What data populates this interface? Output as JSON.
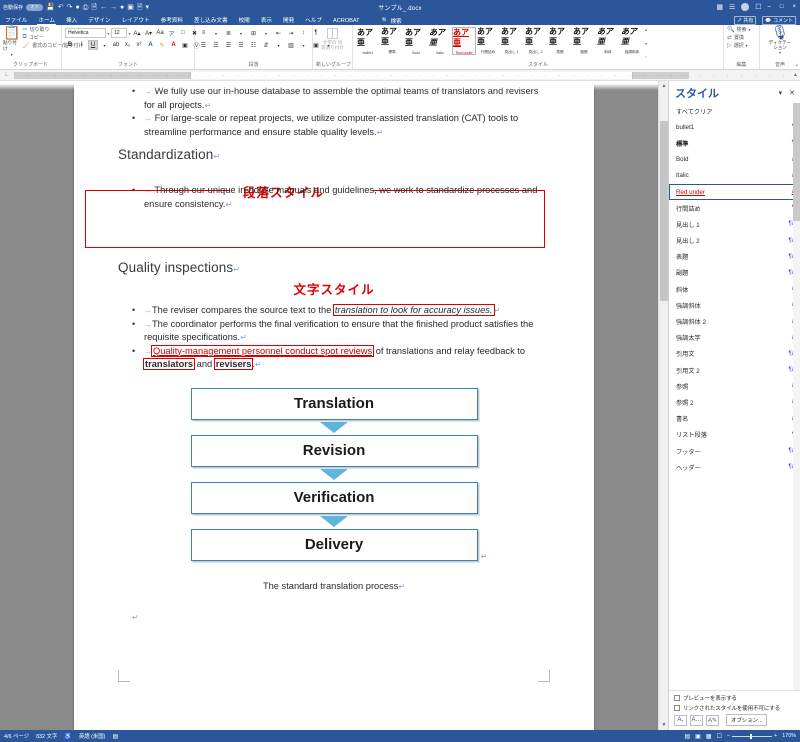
{
  "titlebar": {
    "autosave_label": "自動保存",
    "autosave_state": "オフ",
    "icons": [
      "save-icon",
      "undo-icon",
      "redo-icon",
      "touch-icon",
      "print-preview-icon",
      "open-icon",
      "back-icon",
      "forward-icon",
      "record-icon",
      "style-icon",
      "more-icon"
    ],
    "document_title": "サンプル_.docx",
    "ribbon_display_label": "リボンの表示",
    "account_label": "ユーザー",
    "minimize": "–",
    "maximize": "□",
    "close": "×"
  },
  "tabs": [
    {
      "label": "ファイル",
      "active": false
    },
    {
      "label": "ホーム",
      "active": true
    },
    {
      "label": "挿入",
      "active": false
    },
    {
      "label": "デザイン",
      "active": false
    },
    {
      "label": "レイアウト",
      "active": false
    },
    {
      "label": "参考資料",
      "active": false
    },
    {
      "label": "差し込み文書",
      "active": false
    },
    {
      "label": "校閲",
      "active": false
    },
    {
      "label": "表示",
      "active": false
    },
    {
      "label": "開発",
      "active": false
    },
    {
      "label": "ヘルプ",
      "active": false
    },
    {
      "label": "ACROBAT",
      "active": false
    }
  ],
  "tab_search_label": "検索",
  "tabs_right": [
    {
      "label": "共有",
      "icon": "share-icon"
    },
    {
      "label": "コメント",
      "icon": "comment-icon"
    }
  ],
  "ribbon": {
    "groups": [
      {
        "name": "クリップボード",
        "paste_label": "貼り付け",
        "items": [
          {
            "label": "切り取り",
            "icon": "scissors-icon"
          },
          {
            "label": "コピー",
            "icon": "copy-icon"
          },
          {
            "label": "書式のコピー/貼り付け",
            "icon": "format-painter-icon"
          }
        ]
      },
      {
        "name": "フォント",
        "font_name": "Helvetica",
        "font_size": "12",
        "buttons": [
          "grow-font",
          "shrink-font",
          "change-case",
          "clear-formatting",
          "bold",
          "italic",
          "underline",
          "strikethrough",
          "subscript",
          "superscript",
          "text-effects",
          "text-highlight",
          "font-color",
          "phonetic-guide",
          "character-border"
        ]
      },
      {
        "name": "段落",
        "buttons": [
          "bullets",
          "numbering",
          "multilevel-list",
          "decrease-indent",
          "increase-indent",
          "sort",
          "show-marks",
          "align-left",
          "align-center",
          "align-right",
          "justify",
          "distributed",
          "line-spacing",
          "shading",
          "borders"
        ]
      },
      {
        "name": "新しいグループ",
        "big_label": "文字の\n均等割り付け"
      },
      {
        "name": "スタイル"
      },
      {
        "name": "編集",
        "items": [
          {
            "label": "検索",
            "icon": "search-icon"
          },
          {
            "label": "置換",
            "icon": "replace-icon"
          },
          {
            "label": "選択",
            "icon": "select-icon"
          }
        ]
      },
      {
        "name": "音声",
        "big_label": "ディクテーション",
        "icon": "microphone-icon"
      }
    ],
    "style_gallery": [
      {
        "preview": "あア亜",
        "name": "bullet1",
        "selected": false,
        "kind": "plain"
      },
      {
        "preview": "あア亜",
        "name": "標準",
        "selected": false,
        "kind": "plain"
      },
      {
        "preview": "あア亜",
        "name": "Bold",
        "selected": false,
        "kind": "bold"
      },
      {
        "preview": "あア亜",
        "name": "Italic",
        "selected": false,
        "kind": "italic"
      },
      {
        "preview": "あア亜",
        "name": "Red under",
        "selected": true,
        "kind": "red"
      },
      {
        "preview": "あア亜",
        "name": "行間詰め",
        "selected": false,
        "kind": "plain"
      },
      {
        "preview": "あア亜",
        "name": "見出し 1",
        "selected": false,
        "kind": "plain"
      },
      {
        "preview": "あア亜",
        "name": "見出し 2",
        "selected": false,
        "kind": "plain"
      },
      {
        "preview": "あア亜",
        "name": "表題",
        "selected": false,
        "kind": "plain"
      },
      {
        "preview": "あア亜",
        "name": "副題",
        "selected": false,
        "kind": "plain"
      },
      {
        "preview": "あア亜",
        "name": "斜体",
        "selected": false,
        "kind": "plain"
      },
      {
        "preview": "あア亜",
        "name": "強調斜体",
        "selected": false,
        "kind": "plain"
      }
    ]
  },
  "document": {
    "bullets_top": [
      "We fully use our in-house database to assemble the optimal teams of translators and revisers for all projects.",
      "For large-scale or repeat projects, we utilize computer-assisted translation (CAT) tools to streamline performance and ensure stable quality levels."
    ],
    "heading_standardization": "Standardization",
    "annotation_paragraph_style": "段落スタイル",
    "bullet_standardization": "Through our unique in-house manuals and guidelines, we work to standardize processes and ensure consistency.",
    "heading_quality": "Quality inspections",
    "annotation_character_style": "文字スタイル",
    "quality_bullets": {
      "b1_plain": "The reviser compares the source text to the ",
      "b1_boxed_italic": "translation to look for accuracy issues.",
      "b2": "The coordinator performs the final verification to ensure that the finished product satisfies the requisite specifications.",
      "b3_boxed_redunderline": "Quality-management personnel conduct spot reviews",
      "b3_mid": " of translations and relay feedback to ",
      "b3_bold1": "translators",
      "b3_and": " and ",
      "b3_bold2": "revisers",
      "b3_end": "."
    },
    "flowchart": {
      "steps": [
        "Translation",
        "Revision",
        "Verification",
        "Delivery"
      ],
      "box_border_color": "#2e86c8",
      "arrow_color": "#5fb4de"
    },
    "caption": "The standard translation process"
  },
  "styles_pane": {
    "title": "スタイル",
    "options_icon": "chevron-down-icon",
    "close_icon": "close-icon",
    "items": [
      {
        "label": "すべてクリア",
        "mark": "",
        "kind": "plain"
      },
      {
        "label": "bullet1",
        "mark": "¶",
        "kind": "plain"
      },
      {
        "label": "標準",
        "mark": "¶",
        "kind": "bold"
      },
      {
        "label": "Bold",
        "mark": "a",
        "kind": "plain"
      },
      {
        "label": "Italic",
        "mark": "a",
        "kind": "plain"
      },
      {
        "label": "Red under",
        "mark": "a",
        "kind": "redU",
        "selected": true
      },
      {
        "label": "行間詰め",
        "mark": "¶",
        "kind": "plain"
      },
      {
        "label": "見出し 1",
        "mark": "¶a",
        "kind": "plain"
      },
      {
        "label": "見出し 2",
        "mark": "¶a",
        "kind": "plain"
      },
      {
        "label": "表題",
        "mark": "¶a",
        "kind": "plain"
      },
      {
        "label": "副題",
        "mark": "¶a",
        "kind": "plain"
      },
      {
        "label": "斜体",
        "mark": "a",
        "kind": "plain"
      },
      {
        "label": "強調斜体",
        "mark": "a",
        "kind": "plain"
      },
      {
        "label": "強調斜体 2",
        "mark": "a",
        "kind": "plain"
      },
      {
        "label": "強調太字",
        "mark": "a",
        "kind": "plain"
      },
      {
        "label": "引用文",
        "mark": "¶a",
        "kind": "plain"
      },
      {
        "label": "引用文 2",
        "mark": "¶a",
        "kind": "plain"
      },
      {
        "label": "参照",
        "mark": "a",
        "kind": "plain"
      },
      {
        "label": "参照 2",
        "mark": "a",
        "kind": "plain"
      },
      {
        "label": "書名",
        "mark": "a",
        "kind": "plain"
      },
      {
        "label": "リスト段落",
        "mark": "¶",
        "kind": "plain"
      },
      {
        "label": "フッター",
        "mark": "¶a",
        "kind": "plain"
      },
      {
        "label": "ヘッダー",
        "mark": "¶a",
        "kind": "plain"
      }
    ],
    "footer": {
      "checkbox_preview": "プレビューを表示する",
      "checkbox_disable_linked": "リンクされたスタイルを使用不可にする",
      "buttons": [
        "new-style-button",
        "style-inspector-button",
        "manage-styles-button"
      ],
      "options_label": "オプション..."
    }
  },
  "status_bar": {
    "page": "4/6 ページ",
    "words": "832 文字",
    "accessibility_icon": "accessibility-icon",
    "language": "英語 (米国)",
    "track_changes_icon": "track-changes-icon",
    "view_buttons": [
      "read-mode-icon",
      "print-layout-icon",
      "web-layout-icon",
      "focus-icon"
    ],
    "zoom_out": "−",
    "zoom_in": "+",
    "zoom_level": "170%"
  }
}
